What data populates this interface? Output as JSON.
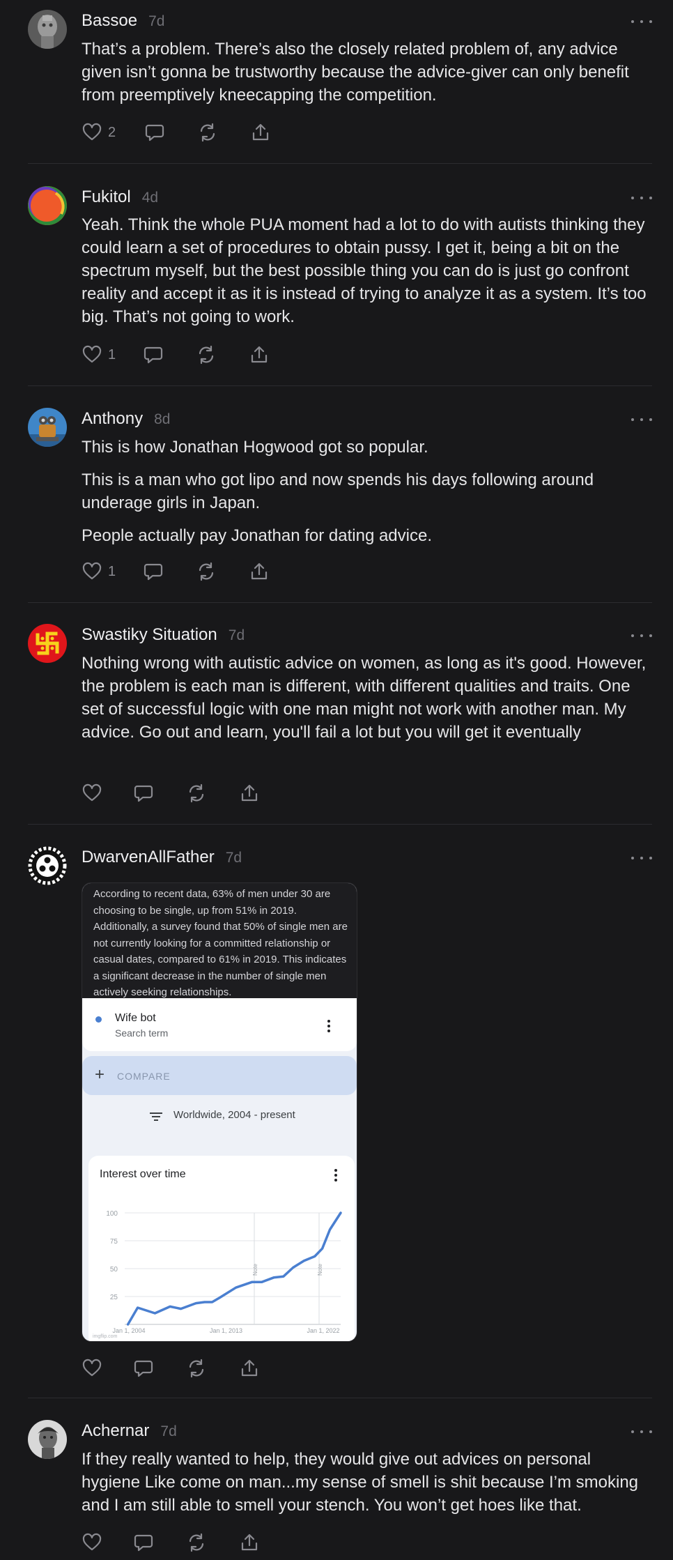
{
  "comments": [
    {
      "author": "Bassoe",
      "time": "7d",
      "paragraphs": [
        "That’s a problem. There’s also the closely related problem of, any advice given isn’t gonna be trustworthy because the advice-giver can only benefit from preemptively kneecapping the competition."
      ],
      "likes": "2",
      "avatar": "stone-head-avatar"
    },
    {
      "author": "Fukitol",
      "time": "4d",
      "paragraphs": [
        "Yeah. Think the whole PUA moment had a lot to do with autists thinking they could learn a set of procedures to obtain pussy. I get it, being a bit on the spectrum myself, but the best possible thing you can do is just go confront reality and accept it as it is instead of trying to analyze it as a system. It’s too big. That’s not going to work."
      ],
      "likes": "1",
      "avatar": "orange-circle-avatar"
    },
    {
      "author": "Anthony",
      "time": "8d",
      "paragraphs": [
        "This is how Jonathan Hogwood got so popular.",
        "This is a man who got lipo and now spends his days following around underage girls in Japan.",
        "People actually pay Jonathan for dating advice."
      ],
      "likes": "1",
      "avatar": "robot-avatar"
    },
    {
      "author": "Swastiky Situation",
      "time": "7d",
      "paragraphs": [
        "Nothing wrong with autistic advice on women, as long as it's good. However, the problem is each man is different, with different qualities and traits. One set of successful logic with one man might not work with another man. My advice. Go out and learn, you'll fail a lot but you will get it eventually"
      ],
      "likes": "",
      "avatar": "red-yellow-symbol-avatar"
    },
    {
      "author": "DwarvenAllFather",
      "time": "7d",
      "paragraphs": [],
      "likes": "",
      "avatar": "white-ring-emblem-avatar"
    },
    {
      "author": "Achernar",
      "time": "7d",
      "paragraphs": [
        "If they really wanted to help, they would give out advices on personal hygiene Like come on man...my sense of smell is shit because I’m smoking and I am still able to smell your stench. You won’t get hoes like that."
      ],
      "likes": "",
      "avatar": "statue-avatar"
    }
  ],
  "embed": {
    "caption": "According to recent data, 63% of men under 30 are choosing to be single, up from 51% in 2019. Additionally, a survey found that 50% of single men are not currently looking for a committed relationship or casual dates, compared to 61% in 2019. This indicates a significant decrease in the number of single men actively seeking relationships.",
    "term_name": "Wife bot",
    "term_sub": "Search term",
    "compare_label": "COMPARE",
    "region_label": "Worldwide, 2004 - present",
    "chart_title": "Interest over time",
    "watermark": "imgflip.com"
  },
  "chart_data": {
    "type": "line",
    "title": "Interest over time",
    "x_tick_labels": [
      "Jan 1, 2004",
      "Jan 1, 2013",
      "Jan 1, 2022"
    ],
    "y_ticks": [
      25,
      50,
      75,
      100
    ],
    "ylim": [
      0,
      100
    ],
    "xlim": [
      2004,
      2024
    ],
    "annotations": [
      {
        "label": "Note",
        "x": 2016
      },
      {
        "label": "Note",
        "x": 2022
      }
    ],
    "series": [
      {
        "color": "#4a7fd0",
        "x": [
          2004.3,
          2005.2,
          2006.8,
          2008.2,
          2009.2,
          2010.6,
          2011.4,
          2012.1,
          2012.8,
          2014.3,
          2015.8,
          2016.7,
          2017.8,
          2018.7,
          2019.6,
          2020.6,
          2021.6,
          2022.3,
          2023.0,
          2024.0
        ],
        "values": [
          0,
          15,
          10,
          16,
          14,
          19,
          20,
          20,
          24,
          33,
          38,
          38,
          42,
          43,
          51,
          57,
          61,
          68,
          85,
          100
        ]
      }
    ]
  },
  "colors": {
    "background": "#18181a",
    "text": "#e6e6e8",
    "muted": "#8a8a90",
    "divider": "#2c2c30",
    "trend_line": "#4a7fd0"
  }
}
